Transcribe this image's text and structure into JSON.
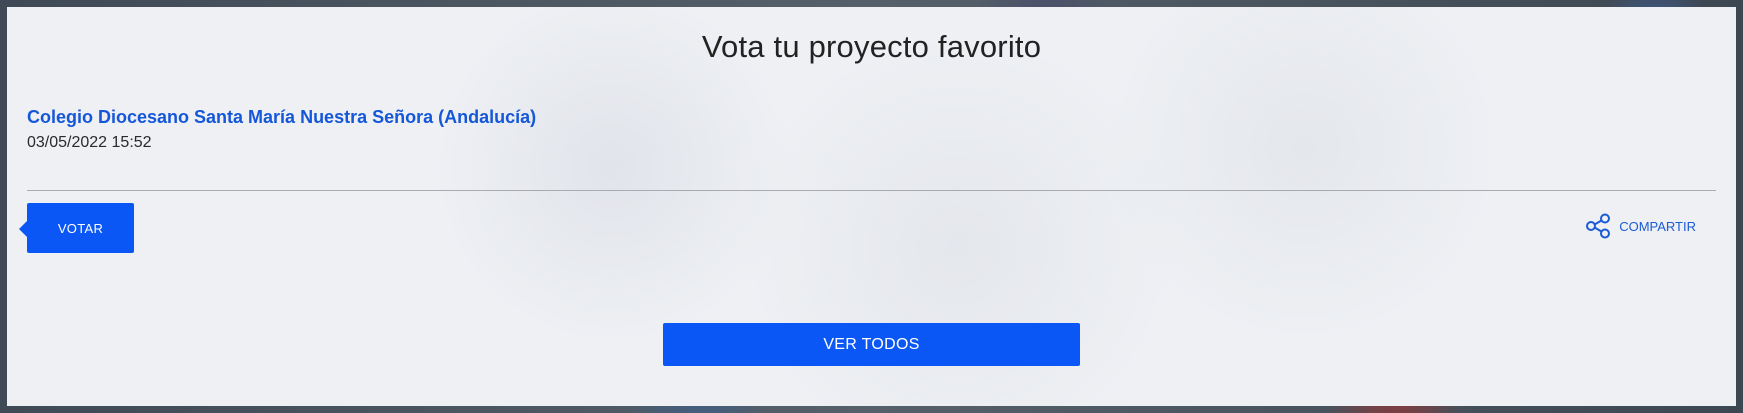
{
  "header": {
    "title": "Vota tu proyecto favorito"
  },
  "entry": {
    "name": "Colegio Diocesano Santa María Nuestra Señora (Andalucía)",
    "date": "03/05/2022 15:52"
  },
  "actions": {
    "vote_label": "VOTAR",
    "share_label": "COMPARTIR",
    "share_icon": "share-icon",
    "view_all_label": "VER TODOS"
  },
  "colors": {
    "accent": "#0b57f5",
    "link": "#1557d9",
    "panel": "#eef0f4"
  }
}
